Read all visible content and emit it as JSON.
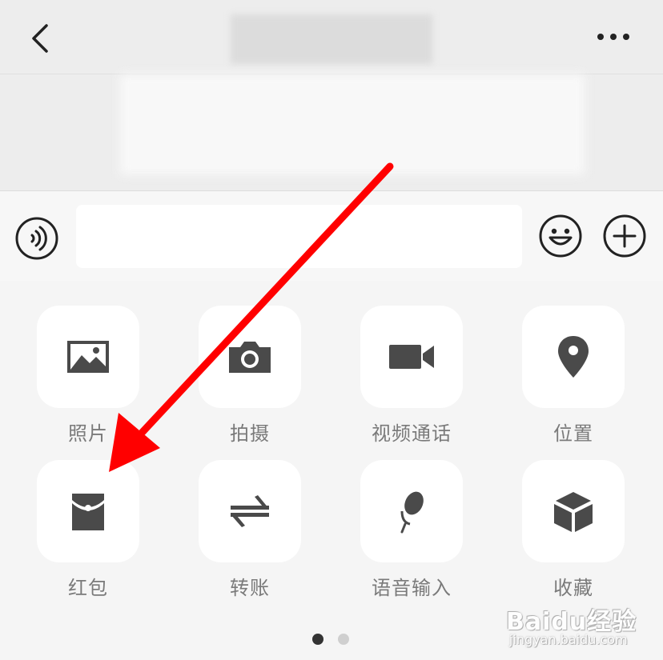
{
  "header": {
    "back_icon": "chevron-left-icon",
    "more_icon": "more-dots-icon"
  },
  "input_bar": {
    "voice_icon": "voice-mode-icon",
    "text_value": "",
    "emoji_icon": "smiley-icon",
    "plus_icon": "plus-circle-icon"
  },
  "panel": {
    "items": [
      {
        "label": "照片",
        "icon": "photo-icon"
      },
      {
        "label": "拍摄",
        "icon": "camera-icon"
      },
      {
        "label": "视频通话",
        "icon": "video-call-icon"
      },
      {
        "label": "位置",
        "icon": "location-pin-icon"
      },
      {
        "label": "红包",
        "icon": "red-packet-icon"
      },
      {
        "label": "转账",
        "icon": "transfer-icon"
      },
      {
        "label": "语音输入",
        "icon": "microphone-icon"
      },
      {
        "label": "收藏",
        "icon": "favorites-cube-icon"
      }
    ],
    "page_indicator": {
      "current": 1,
      "total": 2
    }
  },
  "watermark": {
    "main": "Baidu经验",
    "sub": "jingyan.baidu.com"
  },
  "colors": {
    "icon": "#4a4a4a",
    "label": "#7a7a7a",
    "annotation_arrow": "#ff0000",
    "background": "#f5f5f5"
  }
}
